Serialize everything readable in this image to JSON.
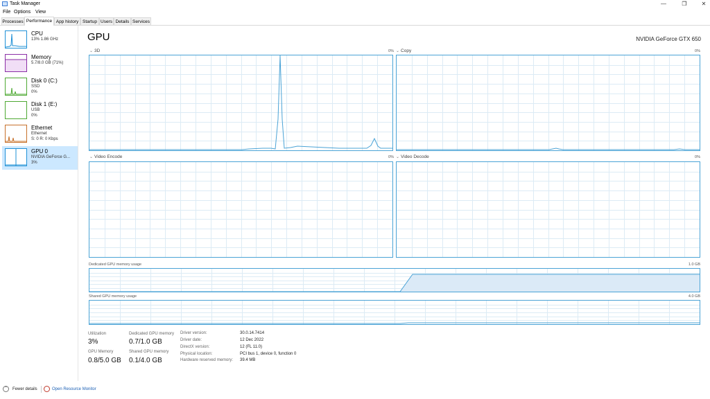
{
  "window": {
    "title": "Task Manager",
    "minimize": "—",
    "restore": "❐",
    "close": "✕"
  },
  "menu": [
    "File",
    "Options",
    "View"
  ],
  "tabs": [
    "Processes",
    "Performance",
    "App history",
    "Startup",
    "Users",
    "Details",
    "Services"
  ],
  "active_tab": "Performance",
  "sidebar": {
    "items": [
      {
        "name": "CPU",
        "sub1": "13%  1.86 GHz",
        "sub2": "",
        "color": "#1e90d6",
        "icon": "cpu-graph-icon"
      },
      {
        "name": "Memory",
        "sub1": "5.7/8.0 GB (71%)",
        "sub2": "",
        "color": "#8b2fa6",
        "icon": "memory-graph-icon"
      },
      {
        "name": "Disk 0 (C:)",
        "sub1": "SSD",
        "sub2": "0%",
        "color": "#4da832",
        "icon": "disk-graph-icon"
      },
      {
        "name": "Disk 1 (E:)",
        "sub1": "USB",
        "sub2": "0%",
        "color": "#4da832",
        "icon": "disk-graph-icon"
      },
      {
        "name": "Ethernet",
        "sub1": "Ethernet",
        "sub2": "S: 0  R: 0 Kbps",
        "color": "#c7702a",
        "icon": "ethernet-graph-icon"
      },
      {
        "name": "GPU 0",
        "sub1": "NVIDIA GeForce G...",
        "sub2": "3%",
        "color": "#1e90d6",
        "icon": "gpu-graph-icon"
      }
    ]
  },
  "main": {
    "title": "GPU",
    "device": "NVIDIA GeForce GTX 650",
    "graphs": [
      {
        "label": "3D",
        "pct": "0%"
      },
      {
        "label": "Copy",
        "pct": "0%"
      },
      {
        "label": "Video Encode",
        "pct": "0%"
      },
      {
        "label": "Video Decode",
        "pct": "0%"
      }
    ],
    "dedicated": {
      "label": "Dedicated GPU memory usage",
      "max": "1.0 GB"
    },
    "shared": {
      "label": "Shared GPU memory usage",
      "max": "4.0 GB"
    }
  },
  "stats": {
    "utilization_label": "Utilization",
    "utilization": "3%",
    "dedicated_label": "Dedicated GPU memory",
    "dedicated": "0.7/1.0 GB",
    "gpu_memory_label": "GPU Memory",
    "gpu_memory": "0.8/5.0 GB",
    "shared_label": "Shared GPU memory",
    "shared": "0.1/4.0 GB"
  },
  "info": [
    {
      "label": "Driver version:",
      "value": "30.0.14.7414"
    },
    {
      "label": "Driver date:",
      "value": "12 Dec 2022"
    },
    {
      "label": "DirectX version:",
      "value": "12 (FL 11.0)"
    },
    {
      "label": "Physical location:",
      "value": "PCI bus 1, device 0, function 0"
    },
    {
      "label": "Hardware reserved memory:",
      "value": "39.4 MB"
    }
  ],
  "footer": {
    "fewer": "Fewer details",
    "monitor": "Open Resource Monitor"
  },
  "colors": {
    "gpu_line": "#4aa3d6",
    "grid": "#dcebf5",
    "selected": "#cce8ff",
    "link": "#1a5fb4"
  }
}
